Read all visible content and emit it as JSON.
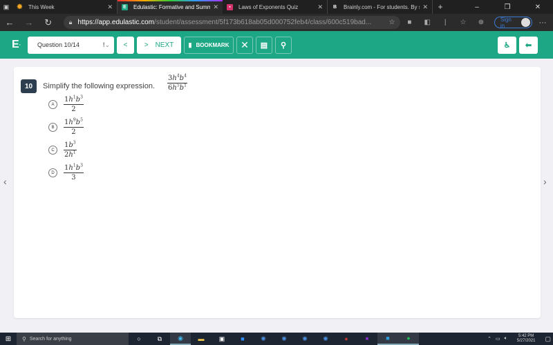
{
  "browser": {
    "tabs": [
      {
        "title": "This Week",
        "icon": "sun-icon",
        "active": false
      },
      {
        "title": "Edulastic: Formative and Summa",
        "icon": "edulastic-icon",
        "active": true
      },
      {
        "title": "Laws of Exponents Quiz",
        "icon": "quiz-icon",
        "active": false
      },
      {
        "title": "Brainly.com - For students. By st",
        "icon": "brainly-icon",
        "active": false
      }
    ],
    "url_host": "https://app.edulastic.com",
    "url_path": "/student/assessment/5f173b618ab05d000752feb4/class/600c519bad...",
    "sign_in_label": "Sign in"
  },
  "toolbar": {
    "logo": "E",
    "question_selector": "Question 10/14",
    "prev_label": "<",
    "next_label": "NEXT",
    "bookmark_label": "BOOKMARK",
    "accent_color": "#1ea784"
  },
  "question": {
    "number": "10",
    "prompt": "Simplify the following expression.",
    "expression": {
      "numerator": {
        "coef": "3",
        "h_exp": "4",
        "b_exp": "4"
      },
      "denominator": {
        "coef": "6",
        "h_exp": "5",
        "b_exp": "1"
      }
    },
    "options": [
      {
        "letter": "A",
        "num": {
          "coef": "1",
          "h_exp": "1",
          "b_exp": "3"
        },
        "den": {
          "coef": "2"
        }
      },
      {
        "letter": "B",
        "num": {
          "coef": "1",
          "h_exp": "9",
          "b_exp": "5"
        },
        "den": {
          "coef": "2"
        }
      },
      {
        "letter": "C",
        "num": {
          "coef": "1",
          "b_exp": "3"
        },
        "den": {
          "coef": "2",
          "h_exp": "1"
        }
      },
      {
        "letter": "D",
        "num": {
          "coef": "1",
          "h_exp": "1",
          "b_exp": "3"
        },
        "den": {
          "coef": "3"
        }
      }
    ]
  },
  "taskbar": {
    "search_placeholder": "Search for anything",
    "time": "5:42 PM",
    "date": "5/27/2021"
  }
}
